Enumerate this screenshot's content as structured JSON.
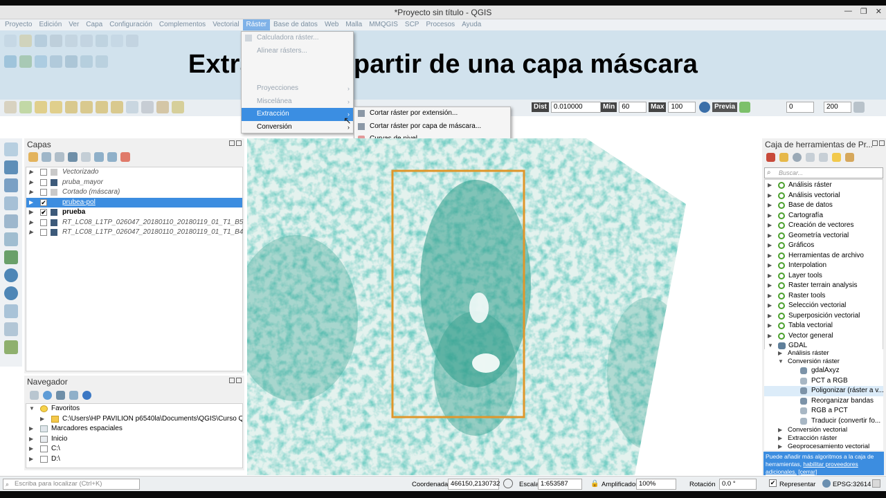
{
  "window": {
    "title": "*Proyecto sin título - QGIS",
    "controls": [
      "—",
      "❐",
      "✕"
    ]
  },
  "menubar": [
    "Proyecto",
    "Edición",
    "Ver",
    "Capa",
    "Configuración",
    "Complementos",
    "Vectorial",
    "Ráster",
    "Base de datos",
    "Web",
    "Malla",
    "MMQGIS",
    "SCP",
    "Procesos",
    "Ayuda"
  ],
  "headline": "Extraemos  a partir de una capa máscara",
  "toolbar_right": {
    "dist_label": "Dist",
    "dist_value": "0.010000",
    "min_label": "Min",
    "min_value": "60",
    "max_label": "Max",
    "max_value": "100",
    "prev_label": "Previa",
    "band_value": "0",
    "size_value": "200"
  },
  "raster_menu": {
    "items": [
      {
        "label": "Calculadora ráster...",
        "disabled": true,
        "submenu": false
      },
      {
        "label": "Alinear rásters...",
        "disabled": true,
        "submenu": false
      },
      {
        "label": "Proyecciones",
        "disabled": true,
        "submenu": true
      },
      {
        "label": "Miscelánea",
        "disabled": true,
        "submenu": true
      },
      {
        "label": "Extracción",
        "disabled": false,
        "submenu": true,
        "highlighted": true
      },
      {
        "label": "Conversión",
        "disabled": false,
        "submenu": true
      }
    ],
    "extraction_submenu": [
      "Cortar ráster por extensión...",
      "Cortar ráster por capa de máscara...",
      "Curvas de nivel..."
    ]
  },
  "layers_panel": {
    "title": "Capas",
    "layers": [
      {
        "name": "Vectorizado",
        "checked": false,
        "style": "it"
      },
      {
        "name": "pruba_mayor",
        "checked": false,
        "style": "it"
      },
      {
        "name": "Cortado (máscara)",
        "checked": false,
        "style": "it"
      },
      {
        "name": "prubea-pol",
        "checked": true,
        "style": "sel"
      },
      {
        "name": "prueba",
        "checked": true,
        "style": "bold"
      },
      {
        "name": "RT_LC08_L1TP_026047_20180110_20180119_01_T1_B5",
        "checked": false,
        "style": "it"
      },
      {
        "name": "RT_LC08_L1TP_026047_20180110_20180119_01_T1_B4",
        "checked": false,
        "style": "it"
      }
    ]
  },
  "navigator_panel": {
    "title": "Navegador",
    "items": [
      {
        "label": "Favoritos",
        "indent": 0,
        "expanded": true
      },
      {
        "label": "C:\\Users\\HP PAVILION p6540la\\Documents\\QGIS\\Curso QGIS",
        "indent": 1,
        "expanded": false
      },
      {
        "label": "Marcadores espaciales",
        "indent": 0,
        "expanded": false
      },
      {
        "label": "Inicio",
        "indent": 0,
        "expanded": false
      },
      {
        "label": "C:\\",
        "indent": 0,
        "expanded": false
      },
      {
        "label": "D:\\",
        "indent": 0,
        "expanded": false
      }
    ]
  },
  "toolbox_panel": {
    "title": "Caja de herramientas de Pr...",
    "search_placeholder": "Buscar...",
    "groups": [
      "Análisis ráster",
      "Análisis vectorial",
      "Base de datos",
      "Cartografía",
      "Creación de vectores",
      "Geometría vectorial",
      "Gráficos",
      "Herramientas de archivo",
      "Interpolation",
      "Layer tools",
      "Raster terrain analysis",
      "Raster tools",
      "Selección vectorial",
      "Superposición vectorial",
      "Tabla vectorial",
      "Vector general"
    ],
    "gdal": {
      "label": "GDAL",
      "children": [
        {
          "label": "Análisis ráster",
          "level": 1
        },
        {
          "label": "Conversión ráster",
          "level": 1
        },
        {
          "label": "gdalAxyz",
          "level": 2
        },
        {
          "label": "PCT a RGB",
          "level": 2
        },
        {
          "label": "Poligonizar (ráster a v...",
          "level": 2,
          "selected": true
        },
        {
          "label": "Reorganizar bandas",
          "level": 2
        },
        {
          "label": "RGB a PCT",
          "level": 2
        },
        {
          "label": "Traducir (convertir fo...",
          "level": 2
        },
        {
          "label": "Conversión vectorial",
          "level": 1
        },
        {
          "label": "Extracción ráster",
          "level": 1
        },
        {
          "label": "Geoprocesamiento vectorial",
          "level": 1
        }
      ]
    },
    "info_text": "Puede añadir más algoritmos a la caja de herramientas,",
    "info_link": "habilitar proveedores adicionales.",
    "info_close": "[cerrar]"
  },
  "statusbar": {
    "search_placeholder": "Escriba para localizar (Ctrl+K)",
    "coord_label": "Coordenada",
    "coord_value": "466150,2130732",
    "scale_label": "Escala",
    "scale_value": "1:653587",
    "mag_label": "Amplificador",
    "mag_value": "100%",
    "rot_label": "Rotación",
    "rot_value": "0.0 °",
    "render_label": "Representar",
    "epsg": "EPSG:32614"
  },
  "colors": {
    "selection": "#3c8de0",
    "mask_outline": "#e0962a",
    "raster_dark": "#2e9e8e",
    "raster_light": "#e8f4f1"
  }
}
